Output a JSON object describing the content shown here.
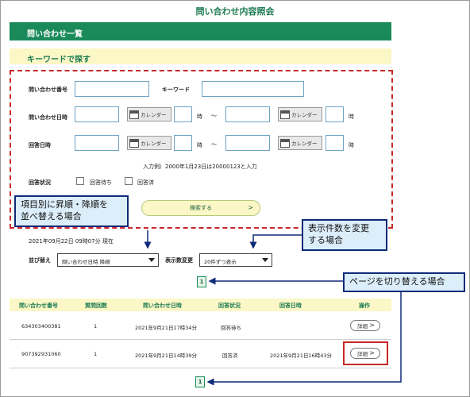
{
  "page_title": "問い合わせ内容照会",
  "section_title": "問い合わせ一覧",
  "search_title": "キーワードで探す",
  "form": {
    "inquiry_number_label": "問い合わせ番号",
    "keyword_label": "キーワード",
    "inquiry_datetime_label": "問い合わせ日時",
    "answer_datetime_label": "回答日時",
    "calendar_label": "カレンダー",
    "hour_label": "時",
    "range_sep": "～",
    "example_text": "入力例）2000年1月23日は20000123と入力",
    "status_label": "回答状況",
    "status_pending": "回答待ち",
    "status_answered": "回答済",
    "search_button": "検索する",
    "search_arrow": ">"
  },
  "list": {
    "timestamp": "2021年09月22日 09時07分 現在",
    "sort_label": "並び替え",
    "sort_value": "問い合わせ日時 降順",
    "display_label": "表示数変更",
    "display_value": "20件ずつ表示",
    "page_number": "1"
  },
  "table": {
    "headers": [
      "問い合わせ番号",
      "質問回数",
      "問い合わせ日時",
      "回答状況",
      "回答日時",
      "操作"
    ],
    "rows": [
      {
        "id": "634303400381",
        "count": "1",
        "inquiry_datetime": "2021年9月21日17時34分",
        "status": "回答待ち",
        "answer_datetime": "",
        "action": "詳細"
      },
      {
        "id": "907392931060",
        "count": "1",
        "inquiry_datetime": "2021年9月21日14時39分",
        "status": "回答済",
        "answer_datetime": "2021年9月21日16時43分",
        "action": "詳細"
      }
    ],
    "action_arrow": ">"
  },
  "callouts": {
    "sort": "項目別に昇順・降順を\n並べ替える場合",
    "display": "表示件数を変更\nする場合",
    "page": "ページを切り替える場合"
  },
  "colors": {
    "brand_green": "#1a8a5a",
    "header_yellow": "#fbf7c6",
    "callout_border": "#0e2a78",
    "highlight_red": "#c62828"
  }
}
